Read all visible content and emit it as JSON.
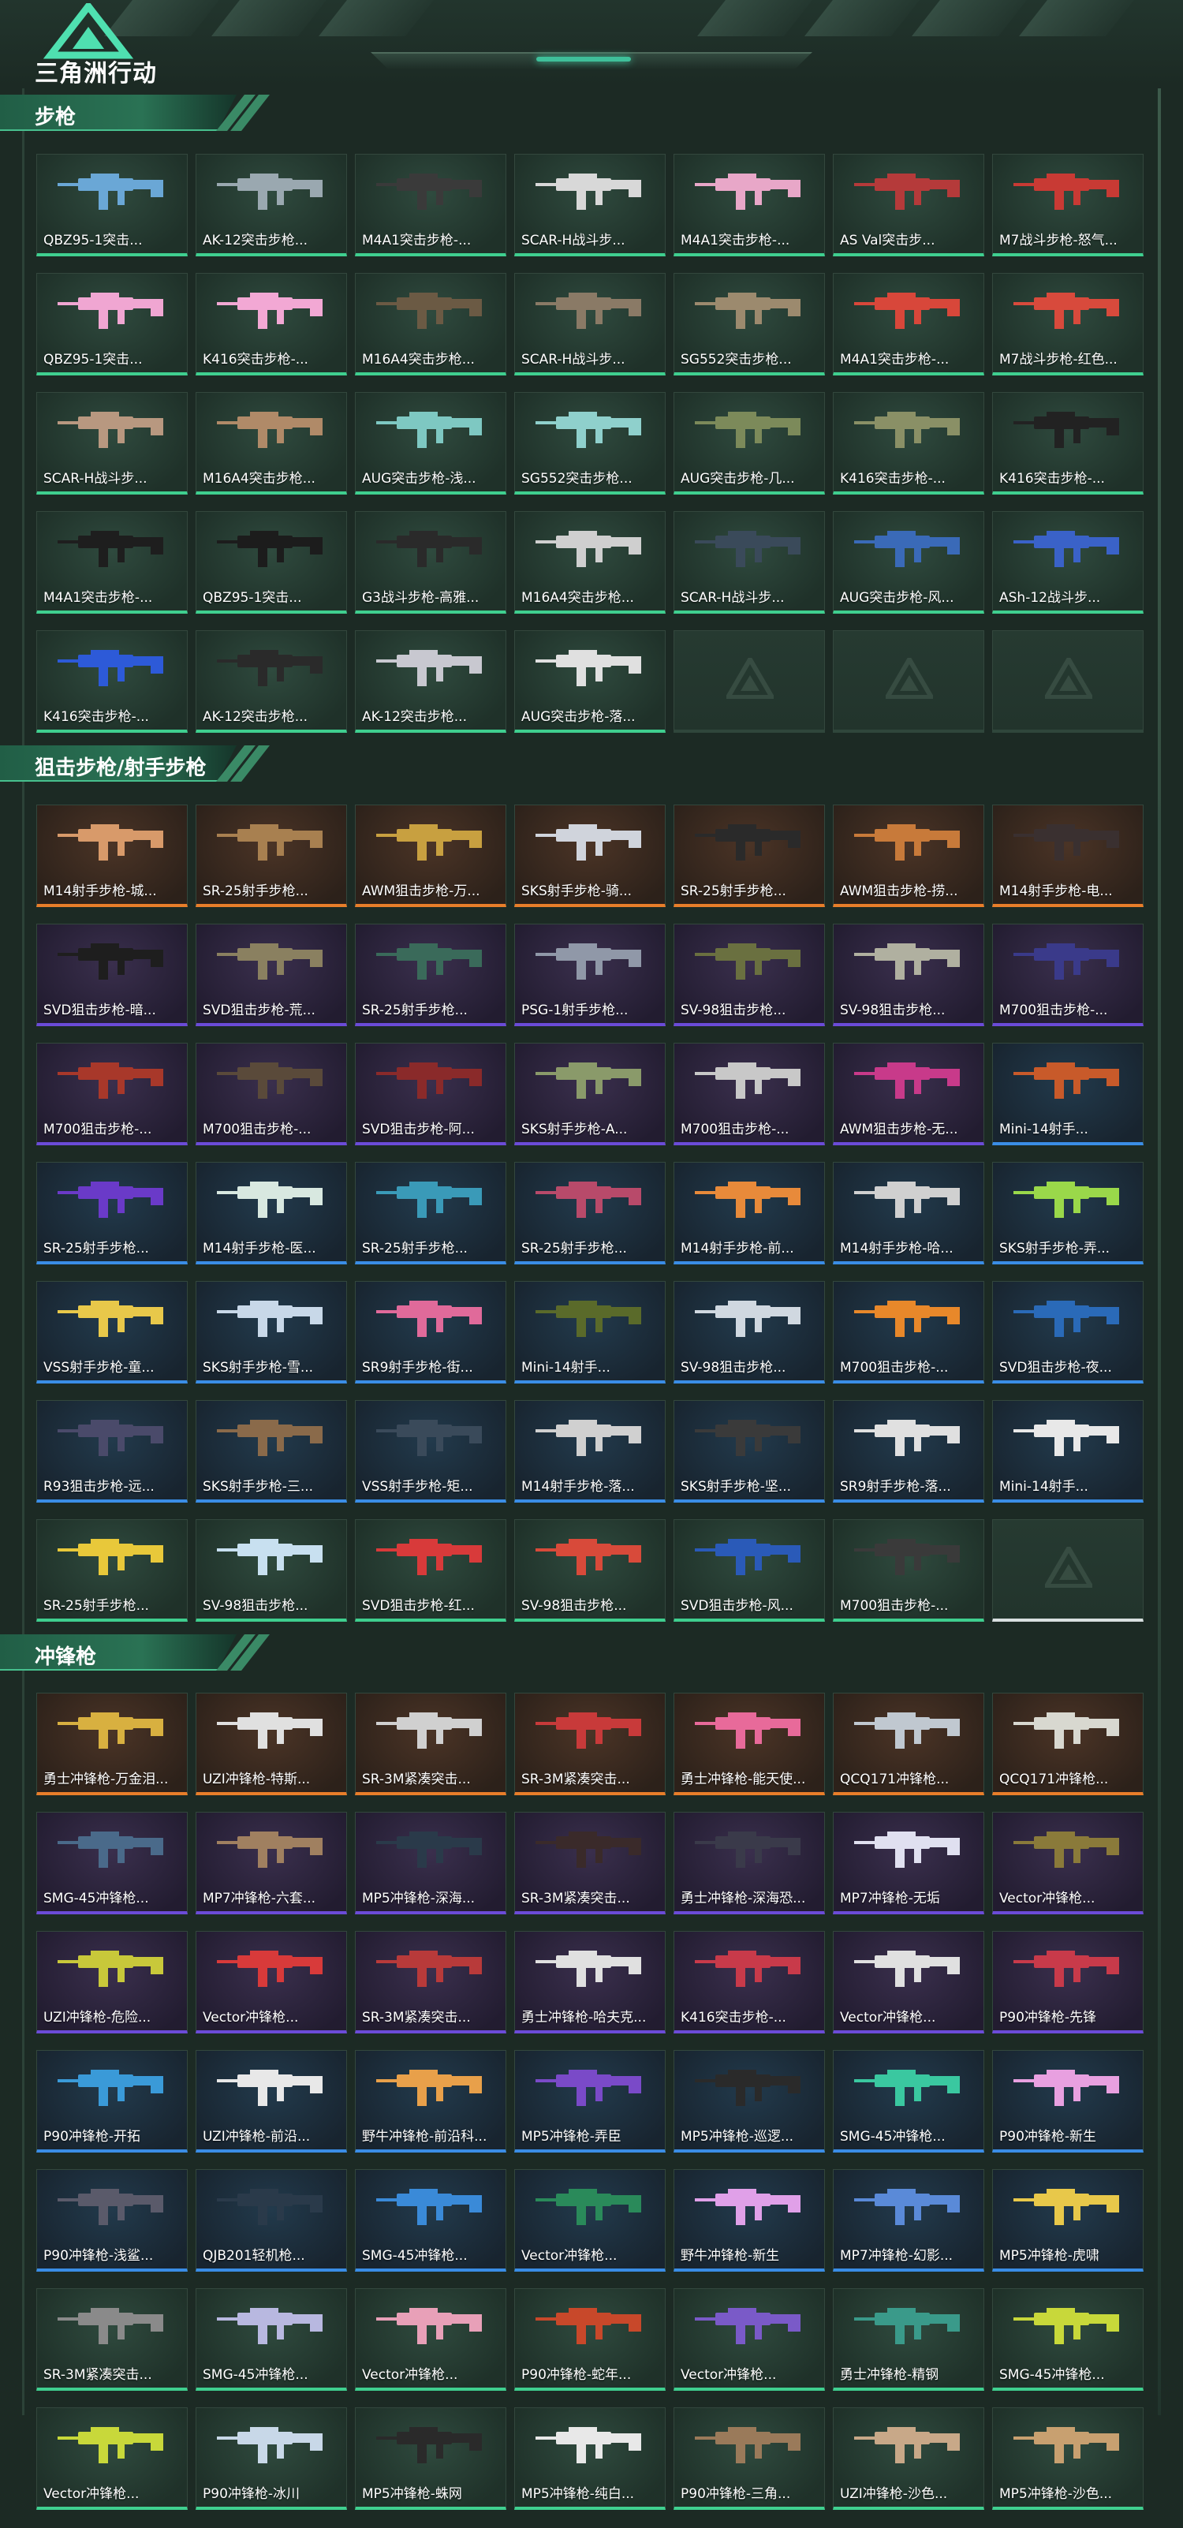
{
  "app": {
    "logo_text": "三角洲行动"
  },
  "colors": {
    "rarity_green": "#3fcf8f",
    "rarity_orange": "#e87e2a",
    "rarity_purple": "#6b4bd8",
    "rarity_blue": "#3a8de6",
    "accent": "#47c08e"
  },
  "sections": [
    {
      "title": "步枪",
      "items": [
        {
          "label": "QBZ95-1突击...",
          "rarity": "green",
          "gun": "#6aa7d6"
        },
        {
          "label": "AK-12突击步枪...",
          "rarity": "green",
          "gun": "#9aa8b0"
        },
        {
          "label": "M4A1突击步枪-...",
          "rarity": "green",
          "gun": "#3a3a3a"
        },
        {
          "label": "SCAR-H战斗步...",
          "rarity": "green",
          "gun": "#d8d8d8"
        },
        {
          "label": "M4A1突击步枪-...",
          "rarity": "green",
          "gun": "#e8a7c8"
        },
        {
          "label": "AS Val突击步...",
          "rarity": "green",
          "gun": "#b53a3a"
        },
        {
          "label": "M7战斗步枪-怒气...",
          "rarity": "green",
          "gun": "#c83a34"
        },
        {
          "label": "QBZ95-1突击...",
          "rarity": "green",
          "gun": "#f0a6d2"
        },
        {
          "label": "K416突击步枪-...",
          "rarity": "green",
          "gun": "#f2a8d4"
        },
        {
          "label": "M16A4突击步枪...",
          "rarity": "green",
          "gun": "#6b5a44"
        },
        {
          "label": "SCAR-H战斗步...",
          "rarity": "green",
          "gun": "#8a7a66"
        },
        {
          "label": "SG552突击步枪...",
          "rarity": "green",
          "gun": "#9c8a6e"
        },
        {
          "label": "M4A1突击步枪-...",
          "rarity": "green",
          "gun": "#d8473a"
        },
        {
          "label": "M7战斗步枪-红色...",
          "rarity": "green",
          "gun": "#d84a3c"
        },
        {
          "label": "SCAR-H战斗步...",
          "rarity": "green",
          "gun": "#b89880"
        },
        {
          "label": "M16A4突击步枪...",
          "rarity": "green",
          "gun": "#b08a68"
        },
        {
          "label": "AUG突击步枪-浅...",
          "rarity": "green",
          "gun": "#7ec8c2"
        },
        {
          "label": "SG552突击步枪...",
          "rarity": "green",
          "gun": "#8fd0cc"
        },
        {
          "label": "AUG突击步枪-几...",
          "rarity": "green",
          "gun": "#7c8a5a"
        },
        {
          "label": "K416突击步枪-...",
          "rarity": "green",
          "gun": "#8a9066"
        },
        {
          "label": "K416突击步枪-...",
          "rarity": "green",
          "gun": "#222222"
        },
        {
          "label": "M4A1突击步枪-...",
          "rarity": "green",
          "gun": "#1e1e1e"
        },
        {
          "label": "QBZ95-1突击...",
          "rarity": "green",
          "gun": "#1c1c1c"
        },
        {
          "label": "G3战斗步枪-高雅...",
          "rarity": "green",
          "gun": "#2a2a2a"
        },
        {
          "label": "M16A4突击步枪...",
          "rarity": "green",
          "gun": "#cfcfcf"
        },
        {
          "label": "SCAR-H战斗步...",
          "rarity": "green",
          "gun": "#3a4a5a"
        },
        {
          "label": "AUG突击步枪-风...",
          "rarity": "green",
          "gun": "#3a6ab8"
        },
        {
          "label": "ASh-12战斗步...",
          "rarity": "green",
          "gun": "#3a62c8"
        },
        {
          "label": "K416突击步枪-...",
          "rarity": "green",
          "gun": "#2d5ad8"
        },
        {
          "label": "AK-12突击步枪...",
          "rarity": "green",
          "gun": "#2a2a2a"
        },
        {
          "label": "AK-12突击步枪...",
          "rarity": "green",
          "gun": "#c8c8d0"
        },
        {
          "label": "AUG突击步枪-落...",
          "rarity": "green",
          "gun": "#e0e0e0"
        },
        {
          "label": "",
          "rarity": "empty",
          "gun": ""
        },
        {
          "label": "",
          "rarity": "empty",
          "gun": ""
        },
        {
          "label": "",
          "rarity": "empty",
          "gun": ""
        }
      ]
    },
    {
      "title": "狙击步枪/射手步枪",
      "items": [
        {
          "label": "M14射手步枪-城...",
          "rarity": "orange",
          "gun": "#d89a6a"
        },
        {
          "label": "SR-25射手步枪...",
          "rarity": "orange",
          "gun": "#a88050"
        },
        {
          "label": "AWM狙击步枪-万...",
          "rarity": "orange",
          "gun": "#c8a040"
        },
        {
          "label": "SKS射手步枪-骑...",
          "rarity": "orange",
          "gun": "#d0d4dc"
        },
        {
          "label": "SR-25射手步枪...",
          "rarity": "orange",
          "gun": "#2a2a2a"
        },
        {
          "label": "AWM狙击步枪-捞...",
          "rarity": "orange",
          "gun": "#c87a3a"
        },
        {
          "label": "M14射手步枪-电...",
          "rarity": "orange",
          "gun": "#3a3030"
        },
        {
          "label": "SVD狙击步枪-暗...",
          "rarity": "purple",
          "gun": "#1e1e1e"
        },
        {
          "label": "SVD狙击步枪-荒...",
          "rarity": "purple",
          "gun": "#8a8060"
        },
        {
          "label": "SR-25射手步枪...",
          "rarity": "purple",
          "gun": "#3a6a5a"
        },
        {
          "label": "PSG-1射手步枪...",
          "rarity": "purple",
          "gun": "#9098a8"
        },
        {
          "label": "SV-98狙击步枪...",
          "rarity": "purple",
          "gun": "#6a7040"
        },
        {
          "label": "SV-98狙击步枪...",
          "rarity": "purple",
          "gun": "#b0b0a0"
        },
        {
          "label": "M700狙击步枪-...",
          "rarity": "purple",
          "gun": "#3a3a8a"
        },
        {
          "label": "M700狙击步枪-...",
          "rarity": "purple",
          "gun": "#a8382a"
        },
        {
          "label": "M700狙击步枪-...",
          "rarity": "purple",
          "gun": "#5a4a3a"
        },
        {
          "label": "SVD狙击步枪-阿...",
          "rarity": "purple",
          "gun": "#8a2a2a"
        },
        {
          "label": "SKS射手步枪-A...",
          "rarity": "purple",
          "gun": "#8a9a6a"
        },
        {
          "label": "M700狙击步枪-...",
          "rarity": "purple",
          "gun": "#c8c8c8"
        },
        {
          "label": "AWM狙击步枪-无...",
          "rarity": "purple",
          "gun": "#c83a8a"
        },
        {
          "label": "Mini-14射手...",
          "rarity": "blue",
          "gun": "#c85a2a"
        },
        {
          "label": "SR-25射手步枪...",
          "rarity": "blue",
          "gun": "#6a3ac8"
        },
        {
          "label": "M14射手步枪-医...",
          "rarity": "blue",
          "gun": "#d8e8e0"
        },
        {
          "label": "SR-25射手步枪...",
          "rarity": "blue",
          "gun": "#3a9ab8"
        },
        {
          "label": "SR-25射手步枪...",
          "rarity": "blue",
          "gun": "#b84a6a"
        },
        {
          "label": "M14射手步枪-前...",
          "rarity": "blue",
          "gun": "#e88a3a"
        },
        {
          "label": "M14射手步枪-哈...",
          "rarity": "blue",
          "gun": "#d0d0d0"
        },
        {
          "label": "SKS射手步枪-弄...",
          "rarity": "blue",
          "gun": "#9ad84a"
        },
        {
          "label": "VSS射手步枪-童...",
          "rarity": "blue",
          "gun": "#e8c84a"
        },
        {
          "label": "SKS射手步枪-雪...",
          "rarity": "blue",
          "gun": "#c8d8e8"
        },
        {
          "label": "SR9射手步枪-街...",
          "rarity": "blue",
          "gun": "#e06a9a"
        },
        {
          "label": "Mini-14射手...",
          "rarity": "blue",
          "gun": "#5a6a2a"
        },
        {
          "label": "SV-98狙击步枪...",
          "rarity": "blue",
          "gun": "#d0d8e0"
        },
        {
          "label": "M700狙击步枪-...",
          "rarity": "blue",
          "gun": "#e8882a"
        },
        {
          "label": "SVD狙击步枪-夜...",
          "rarity": "blue",
          "gun": "#2a6ab8"
        },
        {
          "label": "R93狙击步枪-远...",
          "rarity": "blue",
          "gun": "#4a4a6a"
        },
        {
          "label": "SKS射手步枪-三...",
          "rarity": "blue",
          "gun": "#8a6a4a"
        },
        {
          "label": "VSS射手步枪-矩...",
          "rarity": "blue",
          "gun": "#3a4a5a"
        },
        {
          "label": "M14射手步枪-落...",
          "rarity": "blue",
          "gun": "#d0d0d0"
        },
        {
          "label": "SKS射手步枪-坚...",
          "rarity": "blue",
          "gun": "#3a3a3a"
        },
        {
          "label": "SR9射手步枪-落...",
          "rarity": "blue",
          "gun": "#e0e0e0"
        },
        {
          "label": "Mini-14射手...",
          "rarity": "blue",
          "gun": "#e8e8e8"
        },
        {
          "label": "SR-25射手步枪...",
          "rarity": "green",
          "gun": "#e8c83a"
        },
        {
          "label": "SV-98狙击步枪...",
          "rarity": "green",
          "gun": "#c8e0f0"
        },
        {
          "label": "SVD狙击步枪-红...",
          "rarity": "green",
          "gun": "#d83a3a"
        },
        {
          "label": "SV-98狙击步枪...",
          "rarity": "green",
          "gun": "#d84a3a"
        },
        {
          "label": "SVD狙击步枪-风...",
          "rarity": "green",
          "gun": "#2a5ab8"
        },
        {
          "label": "M700狙击步枪-...",
          "rarity": "green",
          "gun": "#3a3a3a"
        },
        {
          "label": "",
          "rarity": "empty-white",
          "gun": ""
        }
      ]
    },
    {
      "title": "冲锋枪",
      "items": [
        {
          "label": "勇士冲锋枪-万金泪...",
          "rarity": "orange",
          "gun": "#d8b040"
        },
        {
          "label": "UZI冲锋枪-特斯...",
          "rarity": "orange",
          "gun": "#e0e0e0"
        },
        {
          "label": "SR-3M紧凑突击...",
          "rarity": "orange",
          "gun": "#d0d0d0"
        },
        {
          "label": "SR-3M紧凑突击...",
          "rarity": "orange",
          "gun": "#c83a3a"
        },
        {
          "label": "勇士冲锋枪-能天使...",
          "rarity": "orange",
          "gun": "#e86a9a"
        },
        {
          "label": "QCQ171冲锋枪...",
          "rarity": "orange",
          "gun": "#c0c8d0"
        },
        {
          "label": "QCQ171冲锋枪...",
          "rarity": "orange",
          "gun": "#d8d8d0"
        },
        {
          "label": "SMG-45冲锋枪...",
          "rarity": "purple",
          "gun": "#4a6a8a"
        },
        {
          "label": "MP7冲锋枪-六套...",
          "rarity": "purple",
          "gun": "#a08060"
        },
        {
          "label": "MP5冲锋枪-深海...",
          "rarity": "purple",
          "gun": "#2a3a4a"
        },
        {
          "label": "SR-3M紧凑突击...",
          "rarity": "purple",
          "gun": "#3a2a2a"
        },
        {
          "label": "勇士冲锋枪-深海恐...",
          "rarity": "purple",
          "gun": "#3a3a4a"
        },
        {
          "label": "MP7冲锋枪-无垢",
          "rarity": "purple",
          "gun": "#e0e0f0"
        },
        {
          "label": "Vector冲锋枪...",
          "rarity": "purple",
          "gun": "#8a7a3a"
        },
        {
          "label": "UZI冲锋枪-危险...",
          "rarity": "purple",
          "gun": "#c8c83a"
        },
        {
          "label": "Vector冲锋枪...",
          "rarity": "purple",
          "gun": "#d83a3a"
        },
        {
          "label": "SR-3M紧凑突击...",
          "rarity": "purple",
          "gun": "#b83a3a"
        },
        {
          "label": "勇士冲锋枪-哈夫克...",
          "rarity": "purple",
          "gun": "#e0e0e0"
        },
        {
          "label": "K416突击步枪-...",
          "rarity": "purple",
          "gun": "#c83a4a"
        },
        {
          "label": "Vector冲锋枪...",
          "rarity": "purple",
          "gun": "#e0e0e0"
        },
        {
          "label": "P90冲锋枪-先锋",
          "rarity": "purple",
          "gun": "#c83a4a"
        },
        {
          "label": "P90冲锋枪-开拓",
          "rarity": "blue",
          "gun": "#3a9ad8"
        },
        {
          "label": "UZI冲锋枪-前沿...",
          "rarity": "blue",
          "gun": "#e8e8e8"
        },
        {
          "label": "野牛冲锋枪-前沿科...",
          "rarity": "blue",
          "gun": "#e8a04a"
        },
        {
          "label": "MP5冲锋枪-弄臣",
          "rarity": "blue",
          "gun": "#7a4ac8"
        },
        {
          "label": "MP5冲锋枪-巡逻...",
          "rarity": "blue",
          "gun": "#2a2a2a"
        },
        {
          "label": "SMG-45冲锋枪...",
          "rarity": "blue",
          "gun": "#3ac8a0"
        },
        {
          "label": "P90冲锋枪-新生",
          "rarity": "blue",
          "gun": "#e8a0e0"
        },
        {
          "label": "P90冲锋枪-浅鲨...",
          "rarity": "blue",
          "gun": "#5a5a6a"
        },
        {
          "label": "QJB201轻机枪...",
          "rarity": "blue",
          "gun": "#2a3a4a"
        },
        {
          "label": "SMG-45冲锋枪...",
          "rarity": "blue",
          "gun": "#3a8ad8"
        },
        {
          "label": "Vector冲锋枪...",
          "rarity": "blue",
          "gun": "#2a8a5a"
        },
        {
          "label": "野牛冲锋枪-新生",
          "rarity": "blue",
          "gun": "#e0a0e8"
        },
        {
          "label": "MP7冲锋枪-幻影...",
          "rarity": "blue",
          "gun": "#5a8ad8"
        },
        {
          "label": "MP5冲锋枪-虎啸",
          "rarity": "blue",
          "gun": "#e8c84a"
        },
        {
          "label": "SR-3M紧凑突击...",
          "rarity": "green",
          "gun": "#8a8a8a"
        },
        {
          "label": "SMG-45冲锋枪...",
          "rarity": "green",
          "gun": "#b8b8e0"
        },
        {
          "label": "Vector冲锋枪...",
          "rarity": "green",
          "gun": "#e8a0b8"
        },
        {
          "label": "P90冲锋枪-蛇年...",
          "rarity": "green",
          "gun": "#c8482a"
        },
        {
          "label": "Vector冲锋枪...",
          "rarity": "green",
          "gun": "#7a5ac8"
        },
        {
          "label": "勇士冲锋枪-精钢",
          "rarity": "green",
          "gun": "#3a9a8a"
        },
        {
          "label": "SMG-45冲锋枪...",
          "rarity": "green",
          "gun": "#c8d83a"
        },
        {
          "label": "Vector冲锋枪...",
          "rarity": "green",
          "gun": "#c8d83a"
        },
        {
          "label": "P90冲锋枪-冰川",
          "rarity": "green",
          "gun": "#c8d8e8"
        },
        {
          "label": "MP5冲锋枪-蛛网",
          "rarity": "green",
          "gun": "#2a2a2a"
        },
        {
          "label": "MP5冲锋枪-纯白...",
          "rarity": "green",
          "gun": "#e8e8e8"
        },
        {
          "label": "P90冲锋枪-三角...",
          "rarity": "green",
          "gun": "#9a7a5a"
        },
        {
          "label": "UZI冲锋枪-沙色...",
          "rarity": "green",
          "gun": "#c8a888"
        },
        {
          "label": "MP5冲锋枪-沙色...",
          "rarity": "green",
          "gun": "#c8a070"
        }
      ]
    }
  ]
}
